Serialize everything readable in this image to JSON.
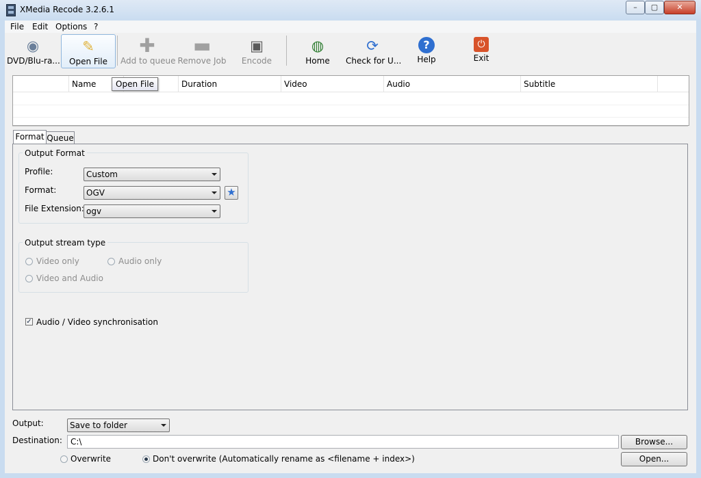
{
  "window": {
    "title": "XMedia Recode 3.2.6.1",
    "min": "–",
    "max": "▢",
    "close": "✕"
  },
  "menu": [
    "File",
    "Edit",
    "Options",
    "?"
  ],
  "toolbar": {
    "dvd": {
      "label": "DVD/Blu-ra...",
      "icon": "disc-icon"
    },
    "open_file": {
      "label": "Open File",
      "icon": "folder-open-icon"
    },
    "add_queue": {
      "label": "Add to queue",
      "icon": "plus-icon"
    },
    "remove_job": {
      "label": "Remove Job",
      "icon": "minus-icon"
    },
    "encode": {
      "label": "Encode",
      "icon": "encode-icon"
    },
    "home": {
      "label": "Home",
      "icon": "globe-icon"
    },
    "check_update": {
      "label": "Check for U...",
      "icon": "refresh-icon"
    },
    "help": {
      "label": "Help",
      "icon": "help-icon"
    },
    "exit": {
      "label": "Exit",
      "icon": "power-icon"
    }
  },
  "file_table": {
    "columns": [
      "",
      "Name",
      "",
      "Duration",
      "Video",
      "Audio",
      "Subtitle"
    ],
    "rows": []
  },
  "tooltip": "Open File",
  "tabs": [
    "Format",
    "Queue"
  ],
  "output_format": {
    "group_title": "Output Format",
    "profile_label": "Profile:",
    "profile_value": "Custom",
    "format_label": "Format:",
    "format_value": "OGV",
    "extension_label": "File Extension:",
    "extension_value": "ogv"
  },
  "stream_type": {
    "group_title": "Output stream type",
    "video_only": "Video only",
    "audio_only": "Audio only",
    "video_audio": "Video and Audio"
  },
  "sync": {
    "label": "Audio / Video synchronisation",
    "checked": true
  },
  "output": {
    "output_label": "Output:",
    "output_value": "Save to folder",
    "destination_label": "Destination:",
    "destination_value": "C:\\",
    "browse": "Browse...",
    "open": "Open...",
    "overwrite": "Overwrite",
    "dont_overwrite": "Don't overwrite (Automatically rename as <filename + index>)"
  },
  "colors": {
    "accent": "#2f6fd0",
    "titlebar": "#c9dcf0",
    "exit": "#d8532a"
  }
}
